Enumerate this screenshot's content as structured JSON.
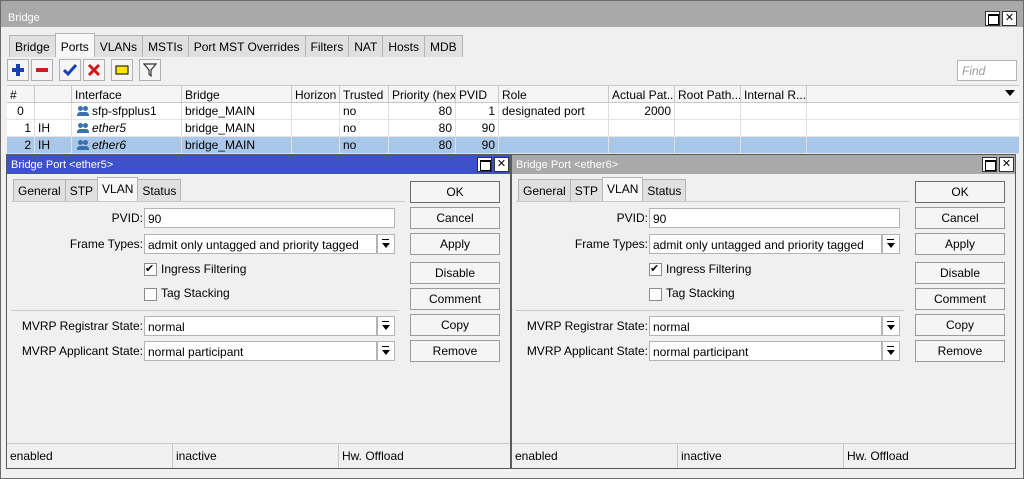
{
  "main_window": {
    "title": "Bridge",
    "tabs": [
      "Bridge",
      "Ports",
      "VLANs",
      "MSTIs",
      "Port MST Overrides",
      "Filters",
      "NAT",
      "Hosts",
      "MDB"
    ],
    "active_tab": "Ports",
    "find_placeholder": "Find",
    "colors": {
      "selected_row": "#a9c7e8",
      "add_icon": "#1a3fb0",
      "remove_icon": "#c81e1e",
      "enable_icon": "#1a3fb0",
      "disable_icon": "#d01818"
    }
  },
  "table": {
    "columns": [
      "#",
      "",
      "Interface",
      "Bridge",
      "Horizon",
      "Trusted",
      "Priority (hex)",
      "PVID",
      "Role",
      "Actual Pat...",
      "Root Path...",
      "Internal R..."
    ],
    "rows": [
      {
        "num": "0",
        "flags": "",
        "interface": "sfp-sfpplus1",
        "bridge": "bridge_MAIN",
        "horizon": "",
        "trusted": "no",
        "priority": "80",
        "pvid": "1",
        "role": "designated port",
        "actual_path": "2000",
        "root_path": "",
        "internal": ""
      },
      {
        "num": "1",
        "flags": "IH",
        "interface": "ether5",
        "bridge": "bridge_MAIN",
        "horizon": "",
        "trusted": "no",
        "priority": "80",
        "pvid": "90",
        "role": "",
        "actual_path": "",
        "root_path": "",
        "internal": ""
      },
      {
        "num": "2",
        "flags": "IH",
        "interface": "ether6",
        "bridge": "bridge_MAIN",
        "horizon": "",
        "trusted": "no",
        "priority": "80",
        "pvid": "90",
        "role": "",
        "actual_path": "",
        "root_path": "",
        "internal": ""
      }
    ]
  },
  "dialogs": [
    {
      "title": "Bridge Port <ether5>",
      "active": true,
      "title_color": "#3f51c8",
      "tabs": [
        "General",
        "STP",
        "VLAN",
        "Status"
      ],
      "active_tab": "VLAN",
      "pvid_label": "PVID:",
      "pvid": "90",
      "frame_types_label": "Frame Types:",
      "frame_types": "admit only untagged and priority tagged",
      "ingress_filtering_label": "Ingress Filtering",
      "ingress_filtering": true,
      "tag_stacking_label": "Tag Stacking",
      "tag_stacking": false,
      "mvrp_registrar_label": "MVRP Registrar State:",
      "mvrp_registrar": "normal",
      "mvrp_applicant_label": "MVRP Applicant State:",
      "mvrp_applicant": "normal participant",
      "buttons": [
        "OK",
        "Cancel",
        "Apply",
        "Disable",
        "Comment",
        "Copy",
        "Remove"
      ],
      "status": [
        "enabled",
        "inactive",
        "Hw. Offload"
      ]
    },
    {
      "title": "Bridge Port <ether6>",
      "active": false,
      "title_color": "#a9a9a9",
      "tabs": [
        "General",
        "STP",
        "VLAN",
        "Status"
      ],
      "active_tab": "VLAN",
      "pvid_label": "PVID:",
      "pvid": "90",
      "frame_types_label": "Frame Types:",
      "frame_types": "admit only untagged and priority tagged",
      "ingress_filtering_label": "Ingress Filtering",
      "ingress_filtering": true,
      "tag_stacking_label": "Tag Stacking",
      "tag_stacking": false,
      "mvrp_registrar_label": "MVRP Registrar State:",
      "mvrp_registrar": "normal",
      "mvrp_applicant_label": "MVRP Applicant State:",
      "mvrp_applicant": "normal participant",
      "buttons": [
        "OK",
        "Cancel",
        "Apply",
        "Disable",
        "Comment",
        "Copy",
        "Remove"
      ],
      "status": [
        "enabled",
        "inactive",
        "Hw. Offload"
      ]
    }
  ]
}
